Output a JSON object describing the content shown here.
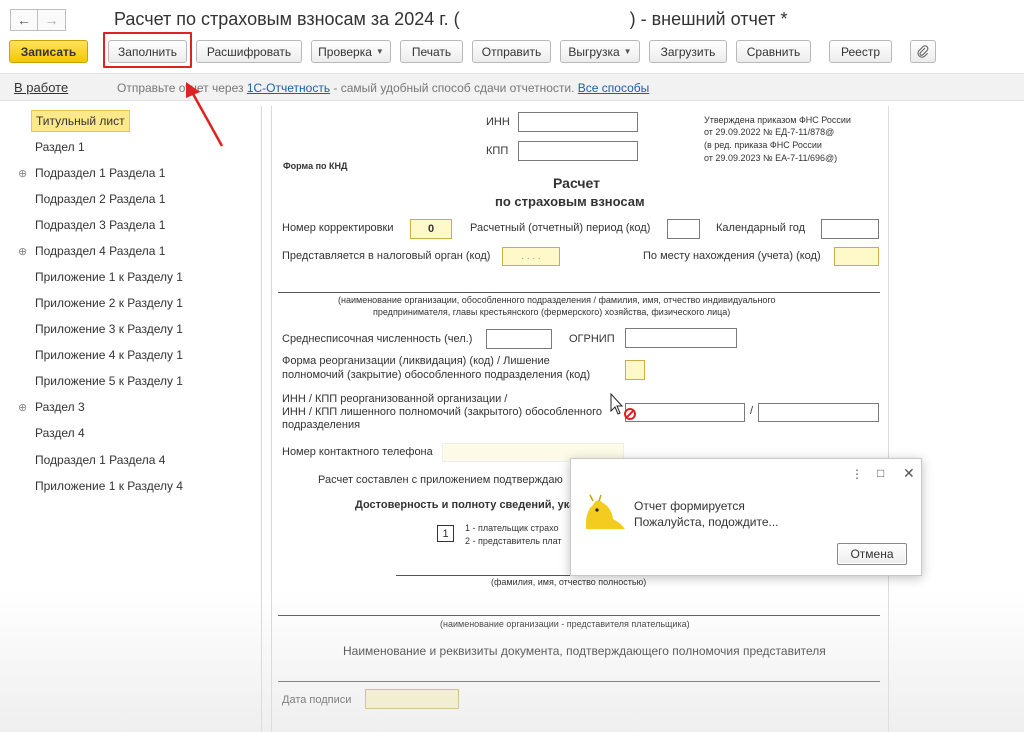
{
  "window": {
    "title_prefix": "Расчет по страховым взносам за 2024 г. (",
    "title_suffix": ") - внешний отчет *"
  },
  "toolbar": {
    "save": "Записать",
    "fill": "Заполнить",
    "decode": "Расшифровать",
    "check": "Проверка",
    "print": "Печать",
    "send": "Отправить",
    "export": "Выгрузка",
    "load": "Загрузить",
    "compare": "Сравнить",
    "registry": "Реестр"
  },
  "status": {
    "state": "В работе",
    "hint_prefix": "Отправьте отчет через ",
    "hint_link": "1С-Отчетность",
    "hint_middle": " - самый удобный способ сдачи отчетности. ",
    "hint_link2": "Все способы"
  },
  "sidebar": {
    "items": [
      {
        "label": "Титульный лист",
        "expandable": false,
        "active": true
      },
      {
        "label": "Раздел 1",
        "expandable": false,
        "active": false
      },
      {
        "label": "Подраздел 1 Раздела 1",
        "expandable": true,
        "active": false
      },
      {
        "label": "Подраздел 2 Раздела 1",
        "expandable": false,
        "active": false
      },
      {
        "label": "Подраздел 3 Раздела 1",
        "expandable": false,
        "active": false
      },
      {
        "label": "Подраздел 4 Раздела 1",
        "expandable": true,
        "active": false
      },
      {
        "label": "Приложение 1 к Разделу 1",
        "expandable": false,
        "active": false
      },
      {
        "label": "Приложение 2 к Разделу 1",
        "expandable": false,
        "active": false
      },
      {
        "label": "Приложение 3 к Разделу 1",
        "expandable": false,
        "active": false
      },
      {
        "label": "Приложение 4 к Разделу 1",
        "expandable": false,
        "active": false
      },
      {
        "label": "Приложение 5 к Разделу 1",
        "expandable": false,
        "active": false
      },
      {
        "label": "Раздел 3",
        "expandable": true,
        "active": false
      },
      {
        "label": "Раздел 4",
        "expandable": false,
        "active": false
      },
      {
        "label": "Подраздел 1 Раздела 4",
        "expandable": false,
        "active": false
      },
      {
        "label": "Приложение 1 к Разделу 4",
        "expandable": false,
        "active": false
      }
    ]
  },
  "form": {
    "inn_label": "ИНН",
    "kpp_label": "КПП",
    "approval_1": "Утверждена приказом ФНС России",
    "approval_2": "от 29.09.2022 № ЕД-7-11/878@",
    "approval_3": "(в ред. приказа ФНС России",
    "approval_4": "от 29.09.2023 № ЕА-7-11/696@)",
    "knd": "Форма по КНД",
    "title_1": "Расчет",
    "title_2": "по страховым взносам",
    "correction_label": "Номер корректировки",
    "correction_value": "0",
    "period_label": "Расчетный (отчетный) период (код)",
    "year_label": "Календарный год",
    "tax_authority_label": "Представляется в налоговый орган (код)",
    "tax_authority_value": ". . . .",
    "location_label": "По месту нахождения (учета) (код)",
    "org_caption_1": "(наименование организации, обособленного подразделения / фамилия, имя, отчество индивидуального",
    "org_caption_2": "предпринимателя, главы крестьянского (фермерского) хозяйства, физического лица)",
    "headcount_label": "Среднесписочная численность (чел.)",
    "ogrnip_label": "ОГРНИП",
    "reorg_label_1": "Форма реорганизации (ликвидация) (код) / Лишение",
    "reorg_label_2": "полномочий (закрытие) обособленного подразделения (код)",
    "reorg_inn_1": "ИНН / КПП реорганизованной организации /",
    "reorg_inn_2": "ИНН / КПП лишенного полномочий (закрытого) обособленного",
    "reorg_inn_3": "подразделения",
    "slash": "/",
    "phone_label": "Номер контактного телефона",
    "attached_label": "Расчет составлен с приложением подтверждаю",
    "reliability_label": "Достоверность и полноту сведений, указ",
    "signer_code": "1",
    "signer_1": "1 - плательщик страхо",
    "signer_2": "2 - представитель плат",
    "fio_caption": "(фамилия, имя, отчество полностью)",
    "rep_caption": "(наименование организации - представителя плательщика)",
    "doc_label": "Наименование и реквизиты документа, подтверждающего полномочия представителя",
    "sign_date_label": "Дата подписи"
  },
  "modal": {
    "message_1": "Отчет формируется",
    "message_2": "Пожалуйста, подождите...",
    "cancel": "Отмена"
  },
  "colors": {
    "highlight": "#dd2222",
    "primary_button": "#f4c800",
    "active_item": "#fde98a",
    "link": "#1b5fa8"
  }
}
